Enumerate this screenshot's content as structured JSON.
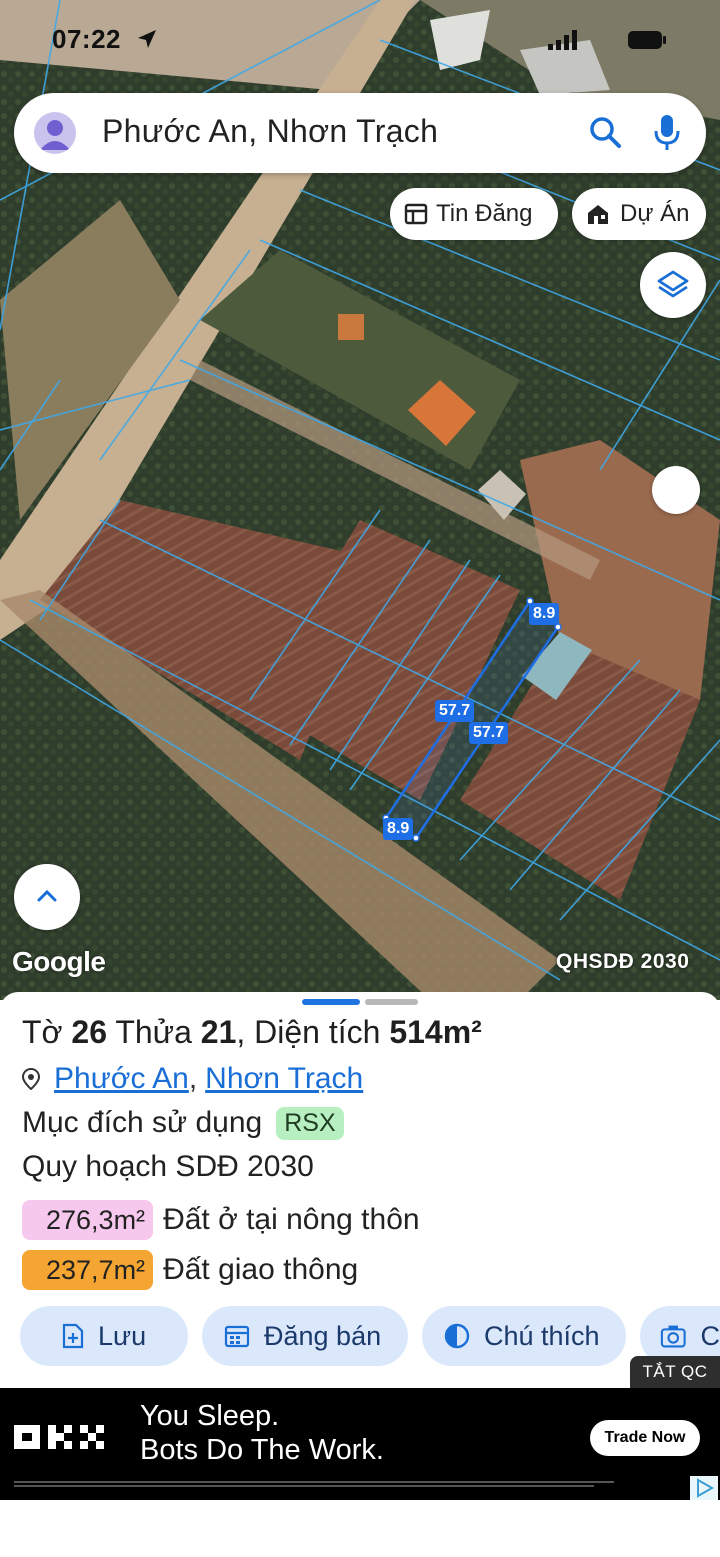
{
  "status_bar": {
    "time": "07:22"
  },
  "search": {
    "text": "Phước An, Nhơn Trạch"
  },
  "chips": {
    "listings": "Tin Đăng",
    "projects": "Dự Án"
  },
  "map": {
    "google_label": "Google",
    "plan_label": "QHSDĐ 2030",
    "dimensions": {
      "top": "8.9",
      "left": "57.7",
      "right": "57.7",
      "bottom": "8.9"
    }
  },
  "parcel": {
    "sheet_label": "Tờ",
    "sheet_no": "26",
    "lot_label": "Thửa",
    "lot_no": "21",
    "area_label": ", Diện tích",
    "area": "514m²",
    "ward": "Phước An",
    "separator": ",",
    "district": "Nhơn Trạch",
    "purpose_label": "Mục đích sử dụng",
    "purpose_code": "RSX",
    "plan_title": "Quy hoạch SDĐ 2030",
    "zones": [
      {
        "area": "276,3m²",
        "name": "Đất ở tại nông thôn",
        "color": "#f7c8ee"
      },
      {
        "area": "237,7m²",
        "name": "Đất giao thông",
        "color": "#f5a531"
      }
    ]
  },
  "actions": {
    "save": "Lưu",
    "sell": "Đăng bán",
    "legend": "Chú thích",
    "capture": "C"
  },
  "ad": {
    "close_label": "TẮT QC",
    "line1": "You Sleep.",
    "line2": "Bots Do The Work.",
    "cta": "Trade Now"
  }
}
